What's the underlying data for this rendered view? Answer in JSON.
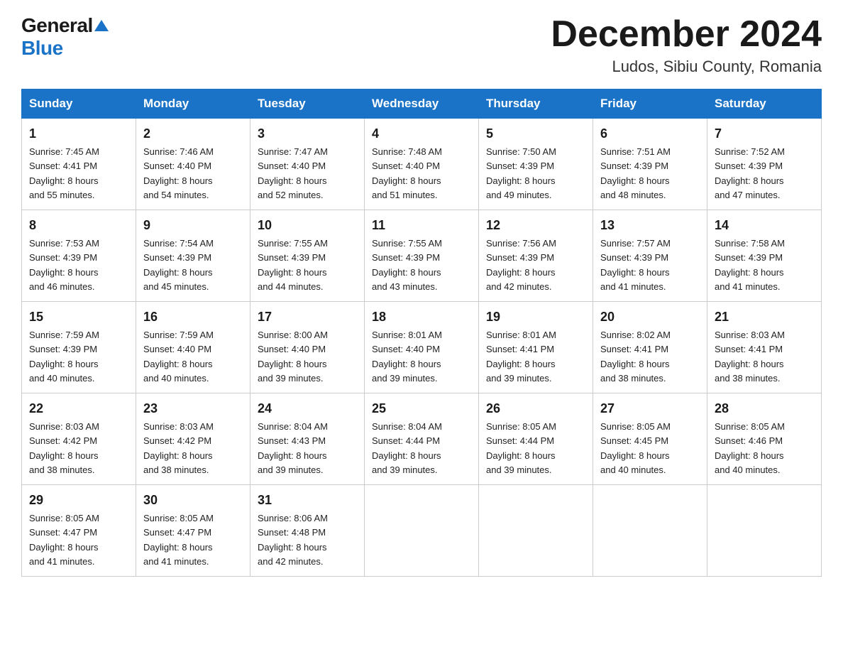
{
  "logo": {
    "general": "General",
    "blue": "Blue"
  },
  "title": {
    "month": "December 2024",
    "location": "Ludos, Sibiu County, Romania"
  },
  "days_header": [
    "Sunday",
    "Monday",
    "Tuesday",
    "Wednesday",
    "Thursday",
    "Friday",
    "Saturday"
  ],
  "weeks": [
    [
      {
        "num": "1",
        "sunrise": "7:45 AM",
        "sunset": "4:41 PM",
        "daylight": "8 hours and 55 minutes."
      },
      {
        "num": "2",
        "sunrise": "7:46 AM",
        "sunset": "4:40 PM",
        "daylight": "8 hours and 54 minutes."
      },
      {
        "num": "3",
        "sunrise": "7:47 AM",
        "sunset": "4:40 PM",
        "daylight": "8 hours and 52 minutes."
      },
      {
        "num": "4",
        "sunrise": "7:48 AM",
        "sunset": "4:40 PM",
        "daylight": "8 hours and 51 minutes."
      },
      {
        "num": "5",
        "sunrise": "7:50 AM",
        "sunset": "4:39 PM",
        "daylight": "8 hours and 49 minutes."
      },
      {
        "num": "6",
        "sunrise": "7:51 AM",
        "sunset": "4:39 PM",
        "daylight": "8 hours and 48 minutes."
      },
      {
        "num": "7",
        "sunrise": "7:52 AM",
        "sunset": "4:39 PM",
        "daylight": "8 hours and 47 minutes."
      }
    ],
    [
      {
        "num": "8",
        "sunrise": "7:53 AM",
        "sunset": "4:39 PM",
        "daylight": "8 hours and 46 minutes."
      },
      {
        "num": "9",
        "sunrise": "7:54 AM",
        "sunset": "4:39 PM",
        "daylight": "8 hours and 45 minutes."
      },
      {
        "num": "10",
        "sunrise": "7:55 AM",
        "sunset": "4:39 PM",
        "daylight": "8 hours and 44 minutes."
      },
      {
        "num": "11",
        "sunrise": "7:55 AM",
        "sunset": "4:39 PM",
        "daylight": "8 hours and 43 minutes."
      },
      {
        "num": "12",
        "sunrise": "7:56 AM",
        "sunset": "4:39 PM",
        "daylight": "8 hours and 42 minutes."
      },
      {
        "num": "13",
        "sunrise": "7:57 AM",
        "sunset": "4:39 PM",
        "daylight": "8 hours and 41 minutes."
      },
      {
        "num": "14",
        "sunrise": "7:58 AM",
        "sunset": "4:39 PM",
        "daylight": "8 hours and 41 minutes."
      }
    ],
    [
      {
        "num": "15",
        "sunrise": "7:59 AM",
        "sunset": "4:39 PM",
        "daylight": "8 hours and 40 minutes."
      },
      {
        "num": "16",
        "sunrise": "7:59 AM",
        "sunset": "4:40 PM",
        "daylight": "8 hours and 40 minutes."
      },
      {
        "num": "17",
        "sunrise": "8:00 AM",
        "sunset": "4:40 PM",
        "daylight": "8 hours and 39 minutes."
      },
      {
        "num": "18",
        "sunrise": "8:01 AM",
        "sunset": "4:40 PM",
        "daylight": "8 hours and 39 minutes."
      },
      {
        "num": "19",
        "sunrise": "8:01 AM",
        "sunset": "4:41 PM",
        "daylight": "8 hours and 39 minutes."
      },
      {
        "num": "20",
        "sunrise": "8:02 AM",
        "sunset": "4:41 PM",
        "daylight": "8 hours and 38 minutes."
      },
      {
        "num": "21",
        "sunrise": "8:03 AM",
        "sunset": "4:41 PM",
        "daylight": "8 hours and 38 minutes."
      }
    ],
    [
      {
        "num": "22",
        "sunrise": "8:03 AM",
        "sunset": "4:42 PM",
        "daylight": "8 hours and 38 minutes."
      },
      {
        "num": "23",
        "sunrise": "8:03 AM",
        "sunset": "4:42 PM",
        "daylight": "8 hours and 38 minutes."
      },
      {
        "num": "24",
        "sunrise": "8:04 AM",
        "sunset": "4:43 PM",
        "daylight": "8 hours and 39 minutes."
      },
      {
        "num": "25",
        "sunrise": "8:04 AM",
        "sunset": "4:44 PM",
        "daylight": "8 hours and 39 minutes."
      },
      {
        "num": "26",
        "sunrise": "8:05 AM",
        "sunset": "4:44 PM",
        "daylight": "8 hours and 39 minutes."
      },
      {
        "num": "27",
        "sunrise": "8:05 AM",
        "sunset": "4:45 PM",
        "daylight": "8 hours and 40 minutes."
      },
      {
        "num": "28",
        "sunrise": "8:05 AM",
        "sunset": "4:46 PM",
        "daylight": "8 hours and 40 minutes."
      }
    ],
    [
      {
        "num": "29",
        "sunrise": "8:05 AM",
        "sunset": "4:47 PM",
        "daylight": "8 hours and 41 minutes."
      },
      {
        "num": "30",
        "sunrise": "8:05 AM",
        "sunset": "4:47 PM",
        "daylight": "8 hours and 41 minutes."
      },
      {
        "num": "31",
        "sunrise": "8:06 AM",
        "sunset": "4:48 PM",
        "daylight": "8 hours and 42 minutes."
      },
      null,
      null,
      null,
      null
    ]
  ],
  "labels": {
    "sunrise": "Sunrise:",
    "sunset": "Sunset:",
    "daylight": "Daylight:"
  }
}
